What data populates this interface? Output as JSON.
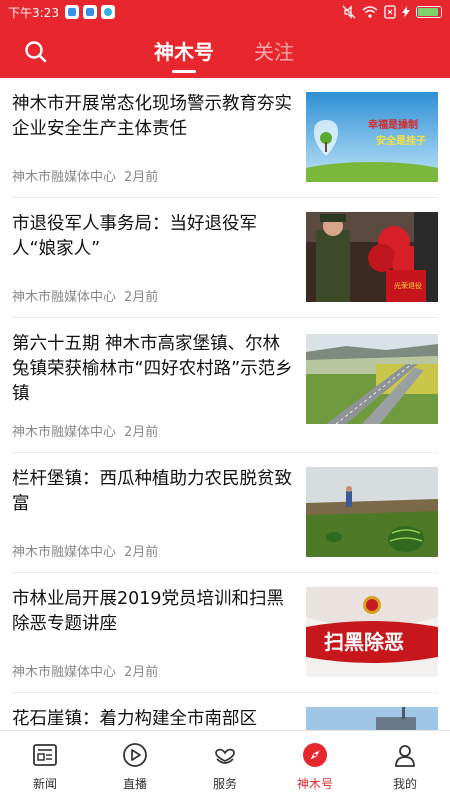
{
  "status_bar": {
    "time": "下午3:23"
  },
  "header": {
    "tabs": [
      {
        "label": "神木号",
        "active": true
      },
      {
        "label": "关注",
        "active": false
      }
    ]
  },
  "feed": [
    {
      "title": "神木市开展常态化现场警示教育夯实企业安全生产主体责任",
      "source": "神木市融媒体中心",
      "time": "2月前",
      "image": "safety-poster",
      "image_text": [
        "幸福是操制",
        "安全是挂子"
      ]
    },
    {
      "title": "市退役军人事务局：当好退役军人“娘家人”",
      "source": "神木市融媒体中心",
      "time": "2月前",
      "image": "veterans-red-flowers",
      "image_text": [
        "光荣退役"
      ]
    },
    {
      "title": "第六十五期 神木市高家堡镇、尔林兔镇荣获榆林市“四好农村路”示范乡镇",
      "source": "神木市融媒体中心",
      "time": "2月前",
      "image": "rural-highway"
    },
    {
      "title": "栏杆堡镇：西瓜种植助力农民脱贫致富",
      "source": "神木市融媒体中心",
      "time": "2月前",
      "image": "watermelon-field"
    },
    {
      "title": "市林业局开展2019党员培训和扫黑除恶专题讲座",
      "source": "神木市融媒体中心",
      "time": "2月前",
      "image": "anti-crime-banner",
      "image_text": [
        "扫黑除恶"
      ]
    },
    {
      "title": "花石崖镇：着力构建全市南部区",
      "source": "",
      "time": "",
      "image": "town-sky"
    }
  ],
  "tabbar": [
    {
      "label": "新闻",
      "icon": "news-icon",
      "active": false
    },
    {
      "label": "直播",
      "icon": "play-icon",
      "active": false
    },
    {
      "label": "服务",
      "icon": "service-icon",
      "active": false
    },
    {
      "label": "神木号",
      "icon": "compass-icon",
      "active": true
    },
    {
      "label": "我的",
      "icon": "user-icon",
      "active": false
    }
  ],
  "colors": {
    "brand_red": "#e8262d",
    "meta_gray": "#8a8a8a",
    "inactive_tab": "#f6a9ac"
  }
}
